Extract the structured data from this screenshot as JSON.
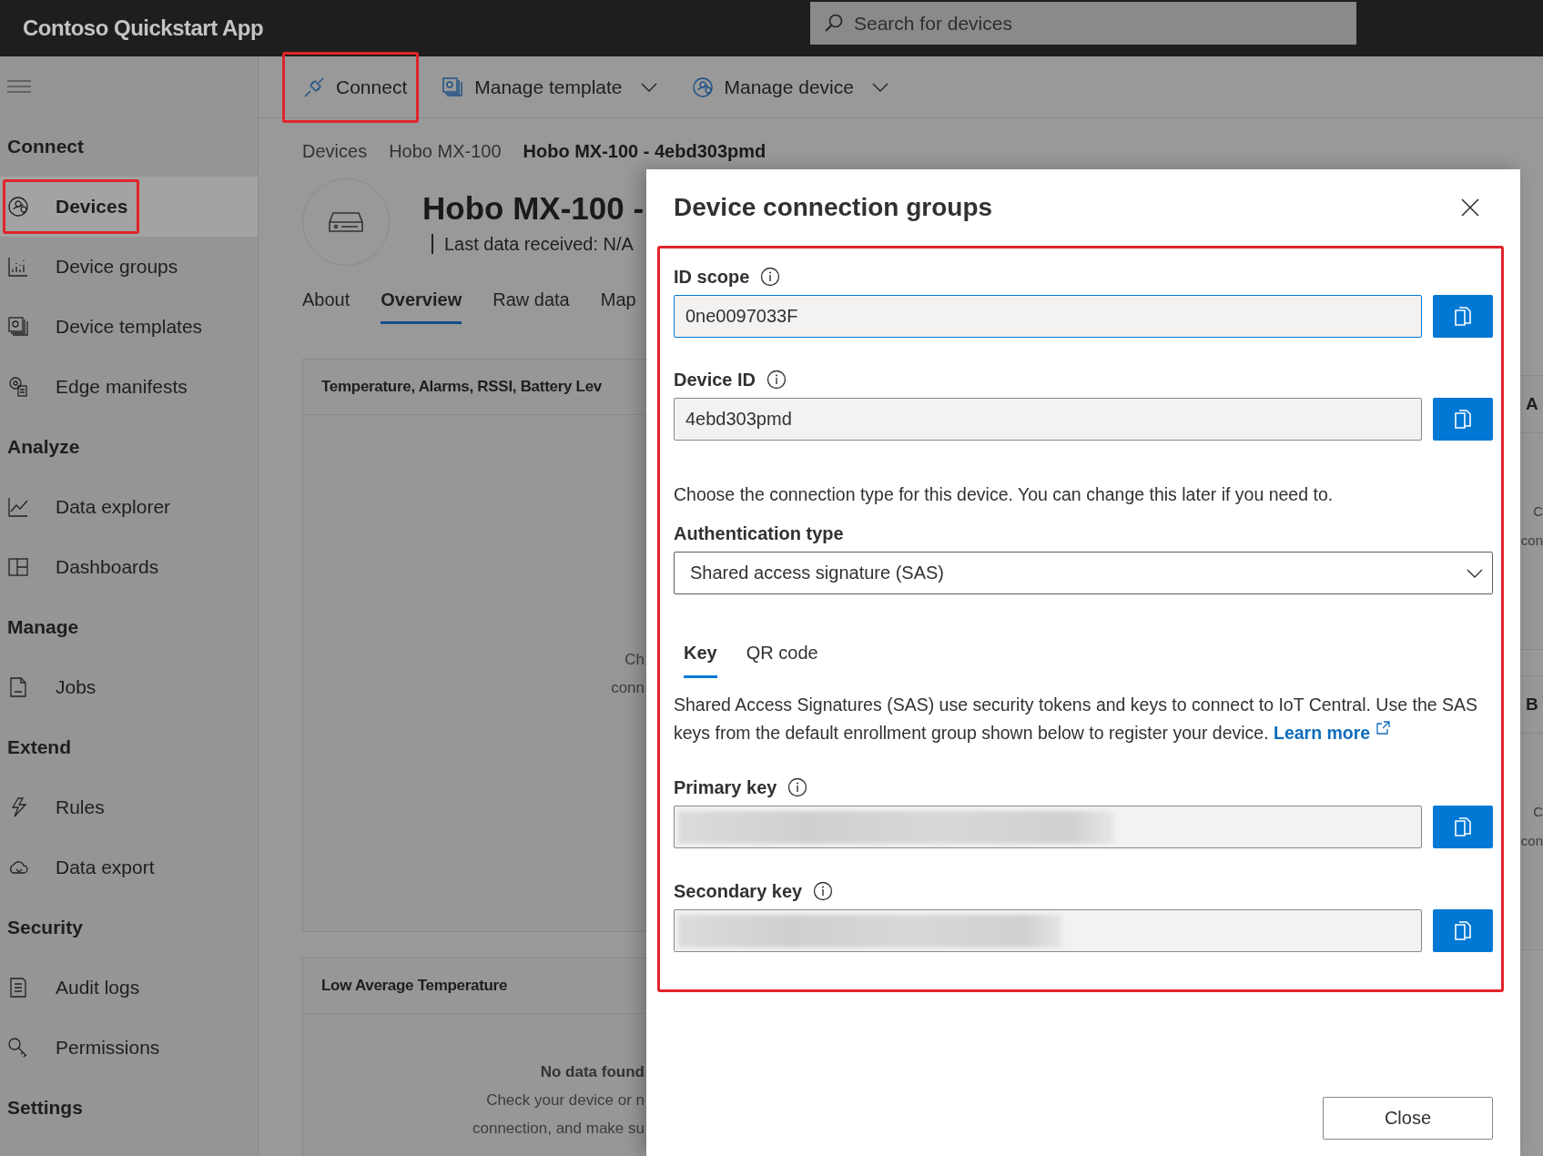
{
  "app": {
    "title": "Contoso Quickstart App",
    "search_placeholder": "Search for devices"
  },
  "sidebar": {
    "sections": [
      {
        "title": "Connect",
        "items": [
          {
            "label": "Devices",
            "kind": "devices",
            "selected": true,
            "highlighted": true
          },
          {
            "label": "Device groups",
            "kind": "groups",
            "selected": false,
            "highlighted": false
          },
          {
            "label": "Device templates",
            "kind": "pages",
            "selected": false,
            "highlighted": false
          },
          {
            "label": "Edge manifests",
            "kind": "gear",
            "selected": false,
            "highlighted": false
          }
        ]
      },
      {
        "title": "Analyze",
        "items": [
          {
            "label": "Data explorer",
            "kind": "linechart",
            "selected": false,
            "highlighted": false
          },
          {
            "label": "Dashboards",
            "kind": "grid",
            "selected": false,
            "highlighted": false
          }
        ]
      },
      {
        "title": "Manage",
        "items": [
          {
            "label": "Jobs",
            "kind": "doc",
            "selected": false,
            "highlighted": false
          }
        ]
      },
      {
        "title": "Extend",
        "items": [
          {
            "label": "Rules",
            "kind": "bolt",
            "selected": false,
            "highlighted": false
          },
          {
            "label": "Data export",
            "kind": "cloud",
            "selected": false,
            "highlighted": false
          }
        ]
      },
      {
        "title": "Security",
        "items": [
          {
            "label": "Audit logs",
            "kind": "list",
            "selected": false,
            "highlighted": false
          },
          {
            "label": "Permissions",
            "kind": "key",
            "selected": false,
            "highlighted": false
          }
        ]
      },
      {
        "title": "Settings"
      }
    ]
  },
  "toolbar": [
    {
      "label": "Connect",
      "kind": "plug",
      "dropdown": false,
      "highlighted": true
    },
    {
      "label": "Manage template",
      "kind": "pages",
      "dropdown": true,
      "highlighted": false
    },
    {
      "label": "Manage device",
      "kind": "devices",
      "dropdown": true,
      "highlighted": false
    }
  ],
  "breadcrumb": [
    "Devices",
    "Hobo MX-100",
    "Hobo MX-100 - 4ebd303pmd"
  ],
  "device": {
    "title": "Hobo MX-100 -",
    "status": "Last data received: N/A"
  },
  "page_tabs": [
    {
      "label": "About",
      "selected": false
    },
    {
      "label": "Overview",
      "selected": true
    },
    {
      "label": "Raw data",
      "selected": false
    },
    {
      "label": "Map",
      "selected": false
    }
  ],
  "cards": [
    {
      "title": "Temperature, Alarms, RSSI, Battery Lev",
      "lines": [
        "Ch",
        "conn"
      ]
    },
    {
      "title": "Low Average Temperature",
      "message": "No data found",
      "lines": [
        "Check your device or n",
        "connection, and make su"
      ]
    }
  ],
  "side_cards": [
    {
      "title": "A",
      "lines": [
        "C",
        "con"
      ]
    },
    {
      "title": "B",
      "lines": [
        "C",
        "con"
      ]
    }
  ],
  "dialog": {
    "title": "Device connection groups",
    "highlighted": true,
    "id_fields": [
      {
        "label": "ID scope",
        "value": "0ne0097033F",
        "redacted": false
      },
      {
        "label": "Device ID",
        "value": "4ebd303pmd",
        "redacted": false
      }
    ],
    "intro": "Choose the connection type for this device. You can change this later if you need to.",
    "auth_label": "Authentication type",
    "auth_value": "Shared access signature (SAS)",
    "tabs": [
      {
        "label": "Key",
        "selected": true
      },
      {
        "label": "QR code",
        "selected": false
      }
    ],
    "description": "Shared Access Signatures (SAS) use security tokens and keys to connect to IoT Central. Use the SAS keys from the default enrollment group shown below to register your device.",
    "link": "Learn more",
    "key_fields": [
      {
        "label": "Primary key",
        "redacted": true
      },
      {
        "label": "Secondary key",
        "redacted": true
      }
    ],
    "close_label": "Close"
  }
}
